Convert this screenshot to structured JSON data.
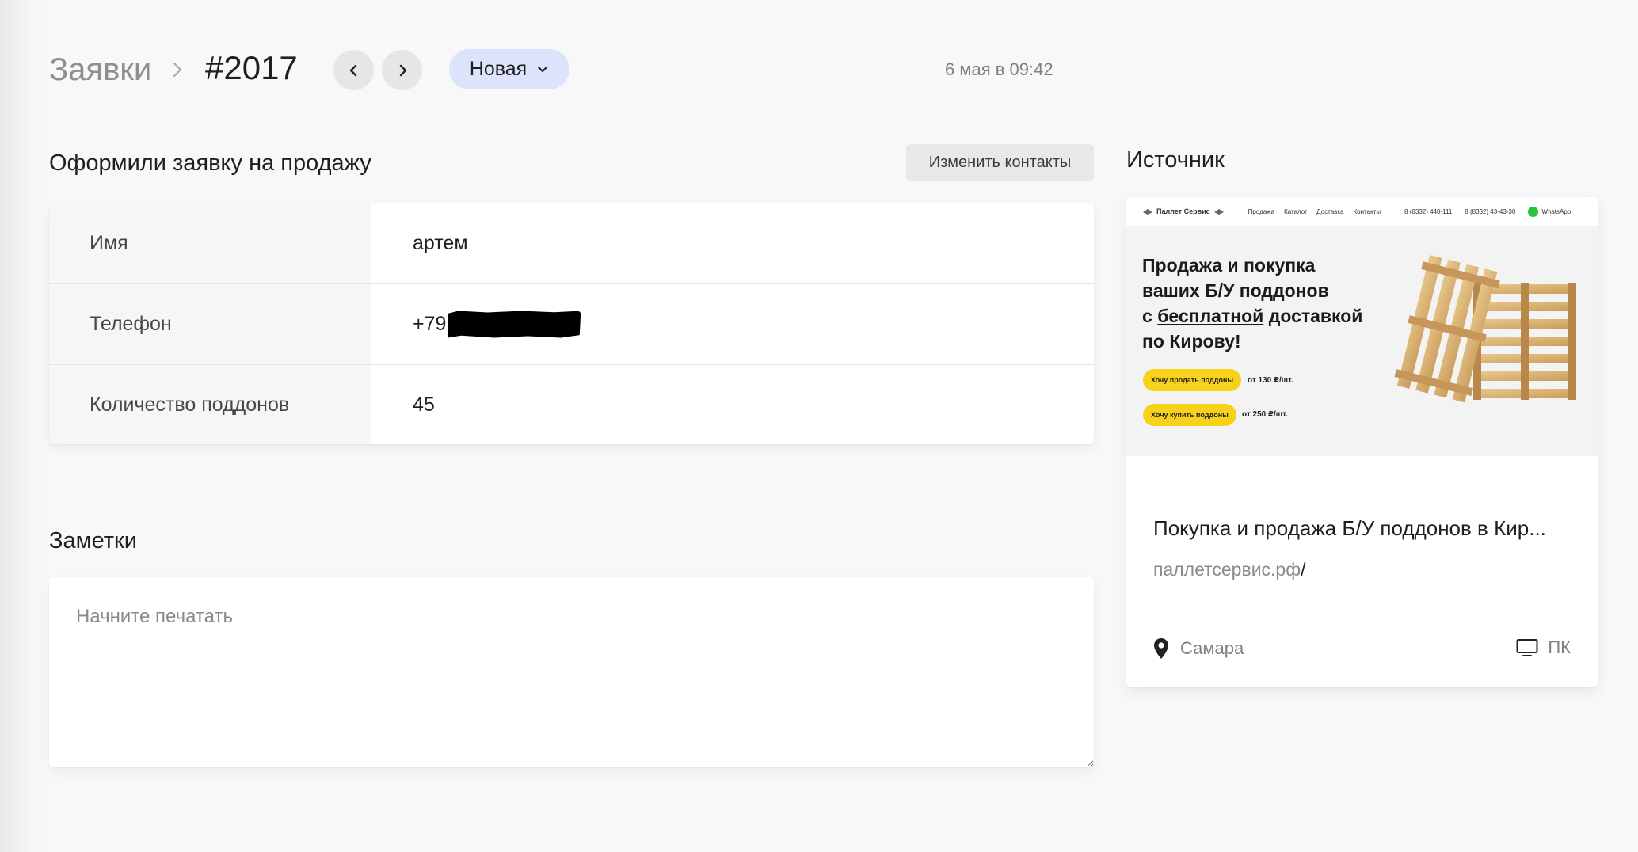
{
  "header": {
    "breadcrumb_root": "Заявки",
    "breadcrumb_current": "#2017",
    "status": "Новая",
    "timestamp": "6 мая в 09:42"
  },
  "deal": {
    "title": "Оформили заявку на продажу",
    "edit_contacts_label": "Изменить контакты",
    "fields": [
      {
        "label": "Имя",
        "value": "артем"
      },
      {
        "label": "Телефон",
        "value": "+79"
      },
      {
        "label": "Количество поддонов",
        "value": "45"
      }
    ]
  },
  "notes": {
    "title": "Заметки",
    "placeholder": "Начните печатать"
  },
  "source": {
    "title": "Источник",
    "page_title": "Покупка и продажа Б/У поддонов в Кир...",
    "url_domain": "паллетсервис.рф",
    "url_path": "/",
    "city": "Самара",
    "device": "ПК",
    "preview": {
      "logo": "Паллет Сервис",
      "nav_links": [
        "Продажа",
        "Каталог",
        "Доставка",
        "Контакты"
      ],
      "phones": [
        "8 (8332) 440-111",
        "8 (8332) 43-43-30"
      ],
      "whatsapp": "WhatsApp",
      "headline_line1": "Продажа и покупка",
      "headline_line2": "ваших Б/У поддонов",
      "headline_line3_pre": "с ",
      "headline_line3_u": "бесплатной",
      "headline_line3_post": " доставкой",
      "headline_line4": "по Кирову!",
      "cta_sell": "Хочу продать поддоны",
      "cta_buy": "Хочу купить поддоны",
      "price_sell": "от 130 ₽/шт.",
      "price_buy": "от 250 ₽/шт."
    }
  },
  "colors": {
    "status_pill_bg": "#dde3fb",
    "cta_yellow": "#f7d21b"
  }
}
